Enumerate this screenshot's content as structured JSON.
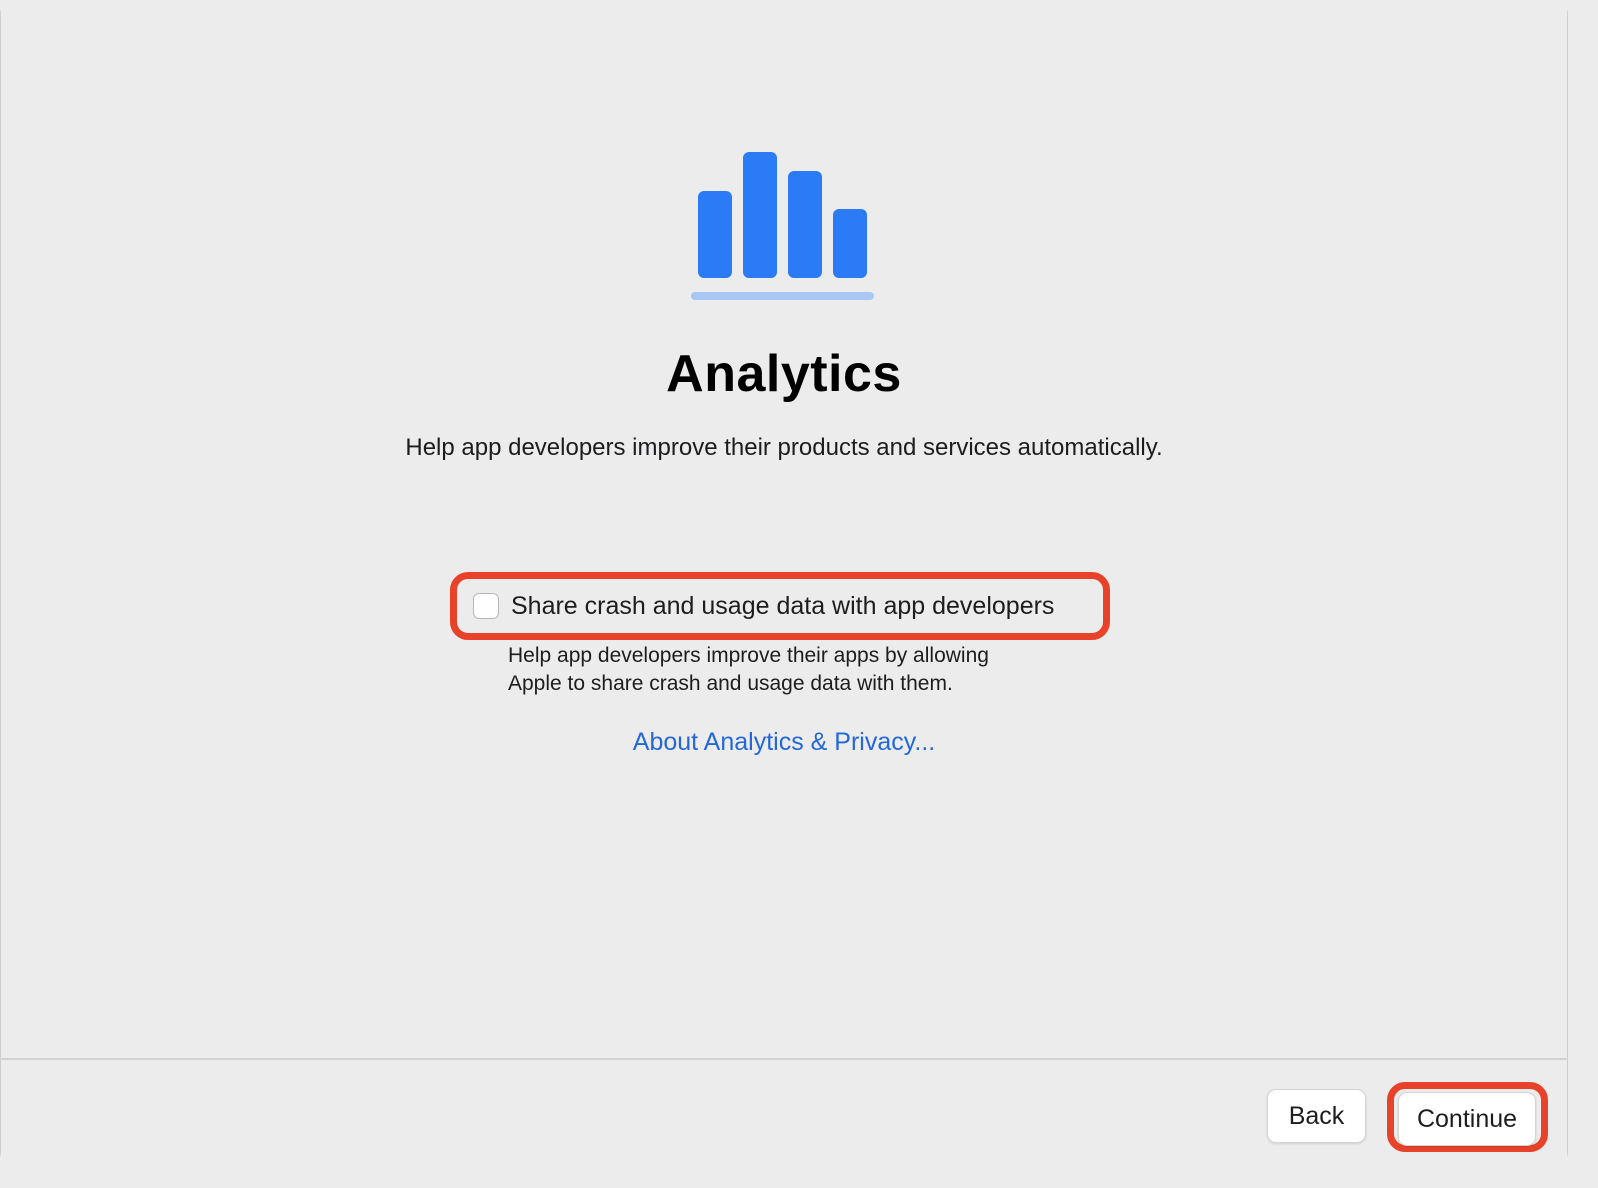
{
  "page": {
    "title": "Analytics",
    "subtitle": "Help app developers improve their products and services automatically."
  },
  "option": {
    "label": "Share crash and usage data with app developers",
    "checked": false,
    "description_line1": "Help app developers improve their apps by allowing",
    "description_line2": "Apple to share crash and usage data with them."
  },
  "link": {
    "label": "About Analytics & Privacy..."
  },
  "buttons": {
    "back_label": "Back",
    "continue_label": "Continue"
  },
  "icons": {
    "hero": "analytics-bar-chart-icon"
  },
  "colors": {
    "accent": "#2b7bf6",
    "accent_light": "#a9c7f5",
    "link": "#2468d8",
    "highlight": "#e8432a",
    "background": "#ececec"
  }
}
